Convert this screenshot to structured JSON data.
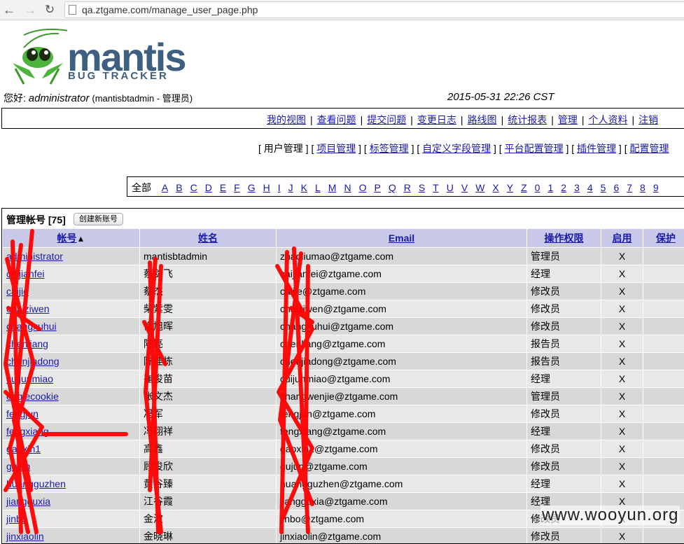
{
  "browser": {
    "url": "qa.ztgame.com/manage_user_page.php"
  },
  "logo": {
    "word": "mantis",
    "sub": "BUG TRACKER"
  },
  "greeting": {
    "prefix": "您好:",
    "username": "administrator",
    "realname": "(mantisbtadmin - 管理员)"
  },
  "datetime": "2015-05-31 22:26 CST",
  "main_menu": [
    "我的视图",
    "查看问题",
    "提交问题",
    "变更日志",
    "路线图",
    "统计报表",
    "管理",
    "个人资料",
    "注销"
  ],
  "sub_menu": {
    "current": "用户管理",
    "links": [
      "项目管理",
      "标签管理",
      "自定义字段管理",
      "平台配置管理",
      "插件管理",
      "配置管理"
    ]
  },
  "alpha_filter": {
    "all": "全部",
    "letters": [
      "A",
      "B",
      "C",
      "D",
      "E",
      "F",
      "G",
      "H",
      "I",
      "J",
      "K",
      "L",
      "M",
      "N",
      "O",
      "P",
      "Q",
      "R",
      "S",
      "T",
      "U",
      "V",
      "W",
      "X",
      "Y",
      "Z",
      "0",
      "1",
      "2",
      "3",
      "4",
      "5",
      "6",
      "7",
      "8",
      "9"
    ]
  },
  "users_panel": {
    "title": "管理帐号",
    "count": "[75]",
    "create_button": "创建新账号",
    "columns": {
      "username": "帐号",
      "realname": "姓名",
      "email": "Email",
      "access": "操作权限",
      "enabled": "启用",
      "protected": "保护"
    },
    "sort_arrow": "▲",
    "rows": [
      {
        "username": "administrator",
        "realname": "mantisbtadmin",
        "email": "zhaoliumao@ztgame.com",
        "access": "管理员",
        "enabled": "X",
        "protected": ""
      },
      {
        "username": "caijianfei",
        "realname": "蔡剑飞",
        "email": "caijianfei@ztgame.com",
        "access": "经理",
        "enabled": "X",
        "protected": ""
      },
      {
        "username": "caijie",
        "realname": "蔡杰",
        "email": "caijie@ztgame.com",
        "access": "修改员",
        "enabled": "X",
        "protected": ""
      },
      {
        "username": "chaiziwen",
        "realname": "柴紫雯",
        "email": "chaiziwen@ztgame.com",
        "access": "修改员",
        "enabled": "X",
        "protected": ""
      },
      {
        "username": "changxuhui",
        "realname": "常旭晖",
        "email": "changxuhui@ztgame.com",
        "access": "修改员",
        "enabled": "X",
        "protected": ""
      },
      {
        "username": "chenliang",
        "realname": "陈亮",
        "email": "chenliang@ztgame.com",
        "access": "报告员",
        "enabled": "X",
        "protected": ""
      },
      {
        "username": "chenjiadong",
        "realname": "陈佳栋",
        "email": "chenjiadong@ztgame.com",
        "access": "报告员",
        "enabled": "X",
        "protected": ""
      },
      {
        "username": "cuijunmiao",
        "realname": "崔俊苗",
        "email": "cuijunmiao@ztgame.com",
        "access": "经理",
        "enabled": "X",
        "protected": ""
      },
      {
        "username": "eaglecookie",
        "realname": "张文杰",
        "email": "zhangwenjie@ztgame.com",
        "access": "管理员",
        "enabled": "X",
        "protected": ""
      },
      {
        "username": "fengjun",
        "realname": "冯军",
        "email": "fengjun@ztgame.com",
        "access": "修改员",
        "enabled": "X",
        "protected": ""
      },
      {
        "username": "fengxiang",
        "realname": "冯翔祥",
        "email": "fengxiang@ztgame.com",
        "access": "经理",
        "enabled": "X",
        "protected": ""
      },
      {
        "username": "gaoxin1",
        "realname": "高鑫",
        "email": "gaoxin1@ztgame.com",
        "access": "修改员",
        "enabled": "X",
        "protected": ""
      },
      {
        "username": "gujun",
        "realname": "顾俊欣",
        "email": "gujun@ztgame.com",
        "access": "修改员",
        "enabled": "X",
        "protected": ""
      },
      {
        "username": "huangguzhen",
        "realname": "黄谷臻",
        "email": "huangguzhen@ztgame.com",
        "access": "经理",
        "enabled": "X",
        "protected": ""
      },
      {
        "username": "jiangguxia",
        "realname": "江谷霞",
        "email": "jiangguxia@ztgame.com",
        "access": "经理",
        "enabled": "X",
        "protected": ""
      },
      {
        "username": "jinbo",
        "realname": "金波",
        "email": "jinbo@ztgame.com",
        "access": "修改员",
        "enabled": "X",
        "protected": ""
      },
      {
        "username": "jinxiaolin",
        "realname": "金晓琳",
        "email": "jinxiaolin@ztgame.com",
        "access": "修改员",
        "enabled": "X",
        "protected": ""
      }
    ]
  },
  "watermark": "www.wooyun.org",
  "colors": {
    "link": "#1a1aa6",
    "header_bg": "#c8c8e8",
    "row_dark": "#d8d8d8",
    "row_light": "#e8e8e8",
    "logo": "#3f5f80",
    "redaction": "#ff0000"
  }
}
